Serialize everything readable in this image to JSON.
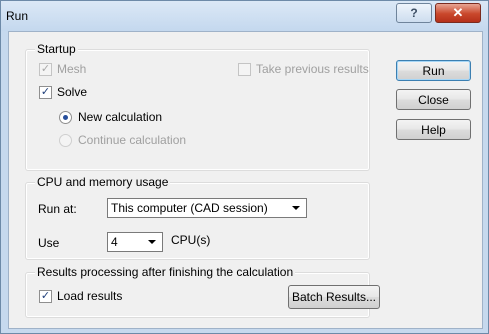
{
  "window": {
    "title": "Run",
    "help_glyph": "?",
    "close_glyph": "✕"
  },
  "startup": {
    "label": "Startup",
    "mesh_label": "Mesh",
    "mesh_checked": true,
    "mesh_enabled": false,
    "take_previous_label": "Take previous results",
    "take_previous_checked": false,
    "take_previous_enabled": false,
    "solve_label": "Solve",
    "solve_checked": true,
    "new_calc_label": "New calculation",
    "new_calc_selected": true,
    "continue_calc_label": "Continue calculation",
    "continue_calc_enabled": false
  },
  "cpu": {
    "label": "CPU and memory usage",
    "run_at_label": "Run at:",
    "run_at_value": "This computer (CAD session)",
    "use_label": "Use",
    "use_value": "4",
    "cpus_label": "CPU(s)"
  },
  "results": {
    "label": "Results processing after finishing the calculation",
    "load_label": "Load results",
    "load_checked": true,
    "batch_button": "Batch Results..."
  },
  "buttons": {
    "run": "Run",
    "close": "Close",
    "help": "Help"
  },
  "check_glyph": "✓"
}
